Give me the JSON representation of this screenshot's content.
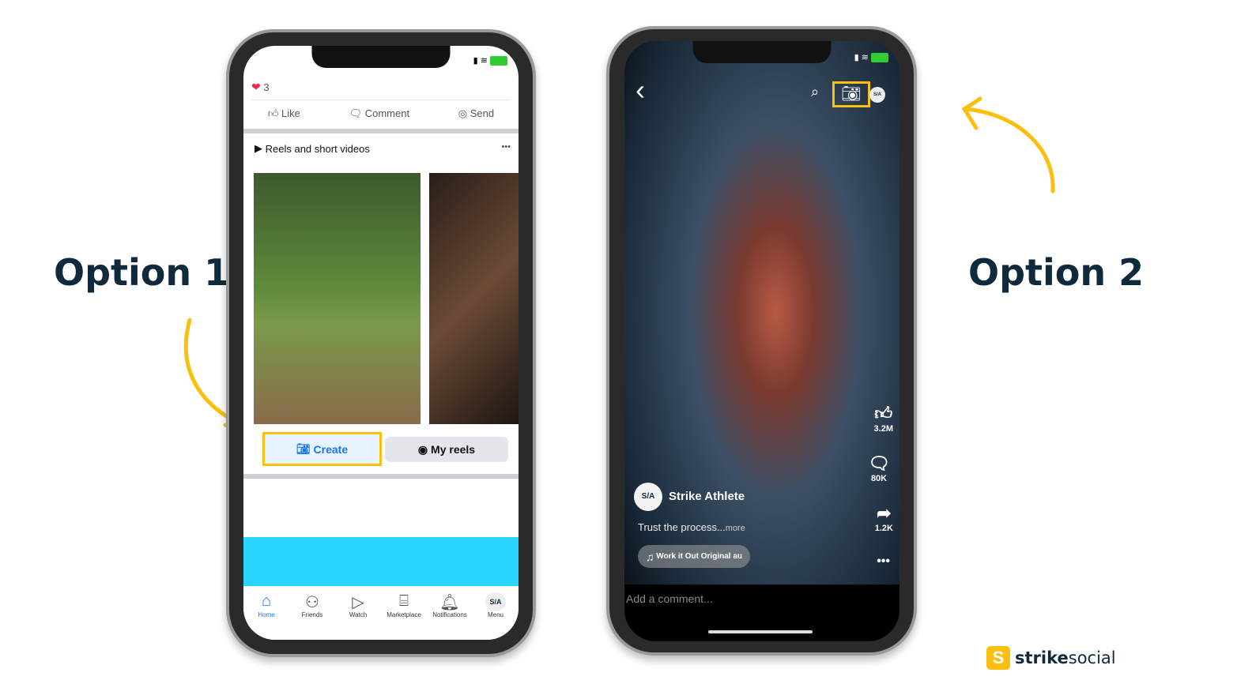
{
  "labels": {
    "option1": "Option 1",
    "option2": "Option 2"
  },
  "phone1": {
    "reaction_count": "3",
    "actions": [
      "Like",
      "Comment",
      "Send"
    ],
    "section_title": "Reels and short videos",
    "more": "•••",
    "create": "Create",
    "my_reels": "My reels",
    "nav": [
      "Home",
      "Friends",
      "Watch",
      "Marketplace",
      "Notifications",
      "Menu"
    ],
    "menu_avatar": "S/A",
    "accent": "#1877f2",
    "highlight": "#fbbf10",
    "banner": "#29d4fd"
  },
  "phone2": {
    "back": "‹",
    "avatar": "S/A",
    "likes": "3.2M",
    "comments": "80K",
    "shares": "1.2K",
    "author": "Strike Athlete",
    "caption": "Trust the process...",
    "caption_more": "more",
    "music": "Work it Out  Original au",
    "comment_placeholder": "Add a comment..."
  },
  "brand": {
    "name_bold": "strike",
    "name_light": "social",
    "color": "#fbbf10"
  }
}
